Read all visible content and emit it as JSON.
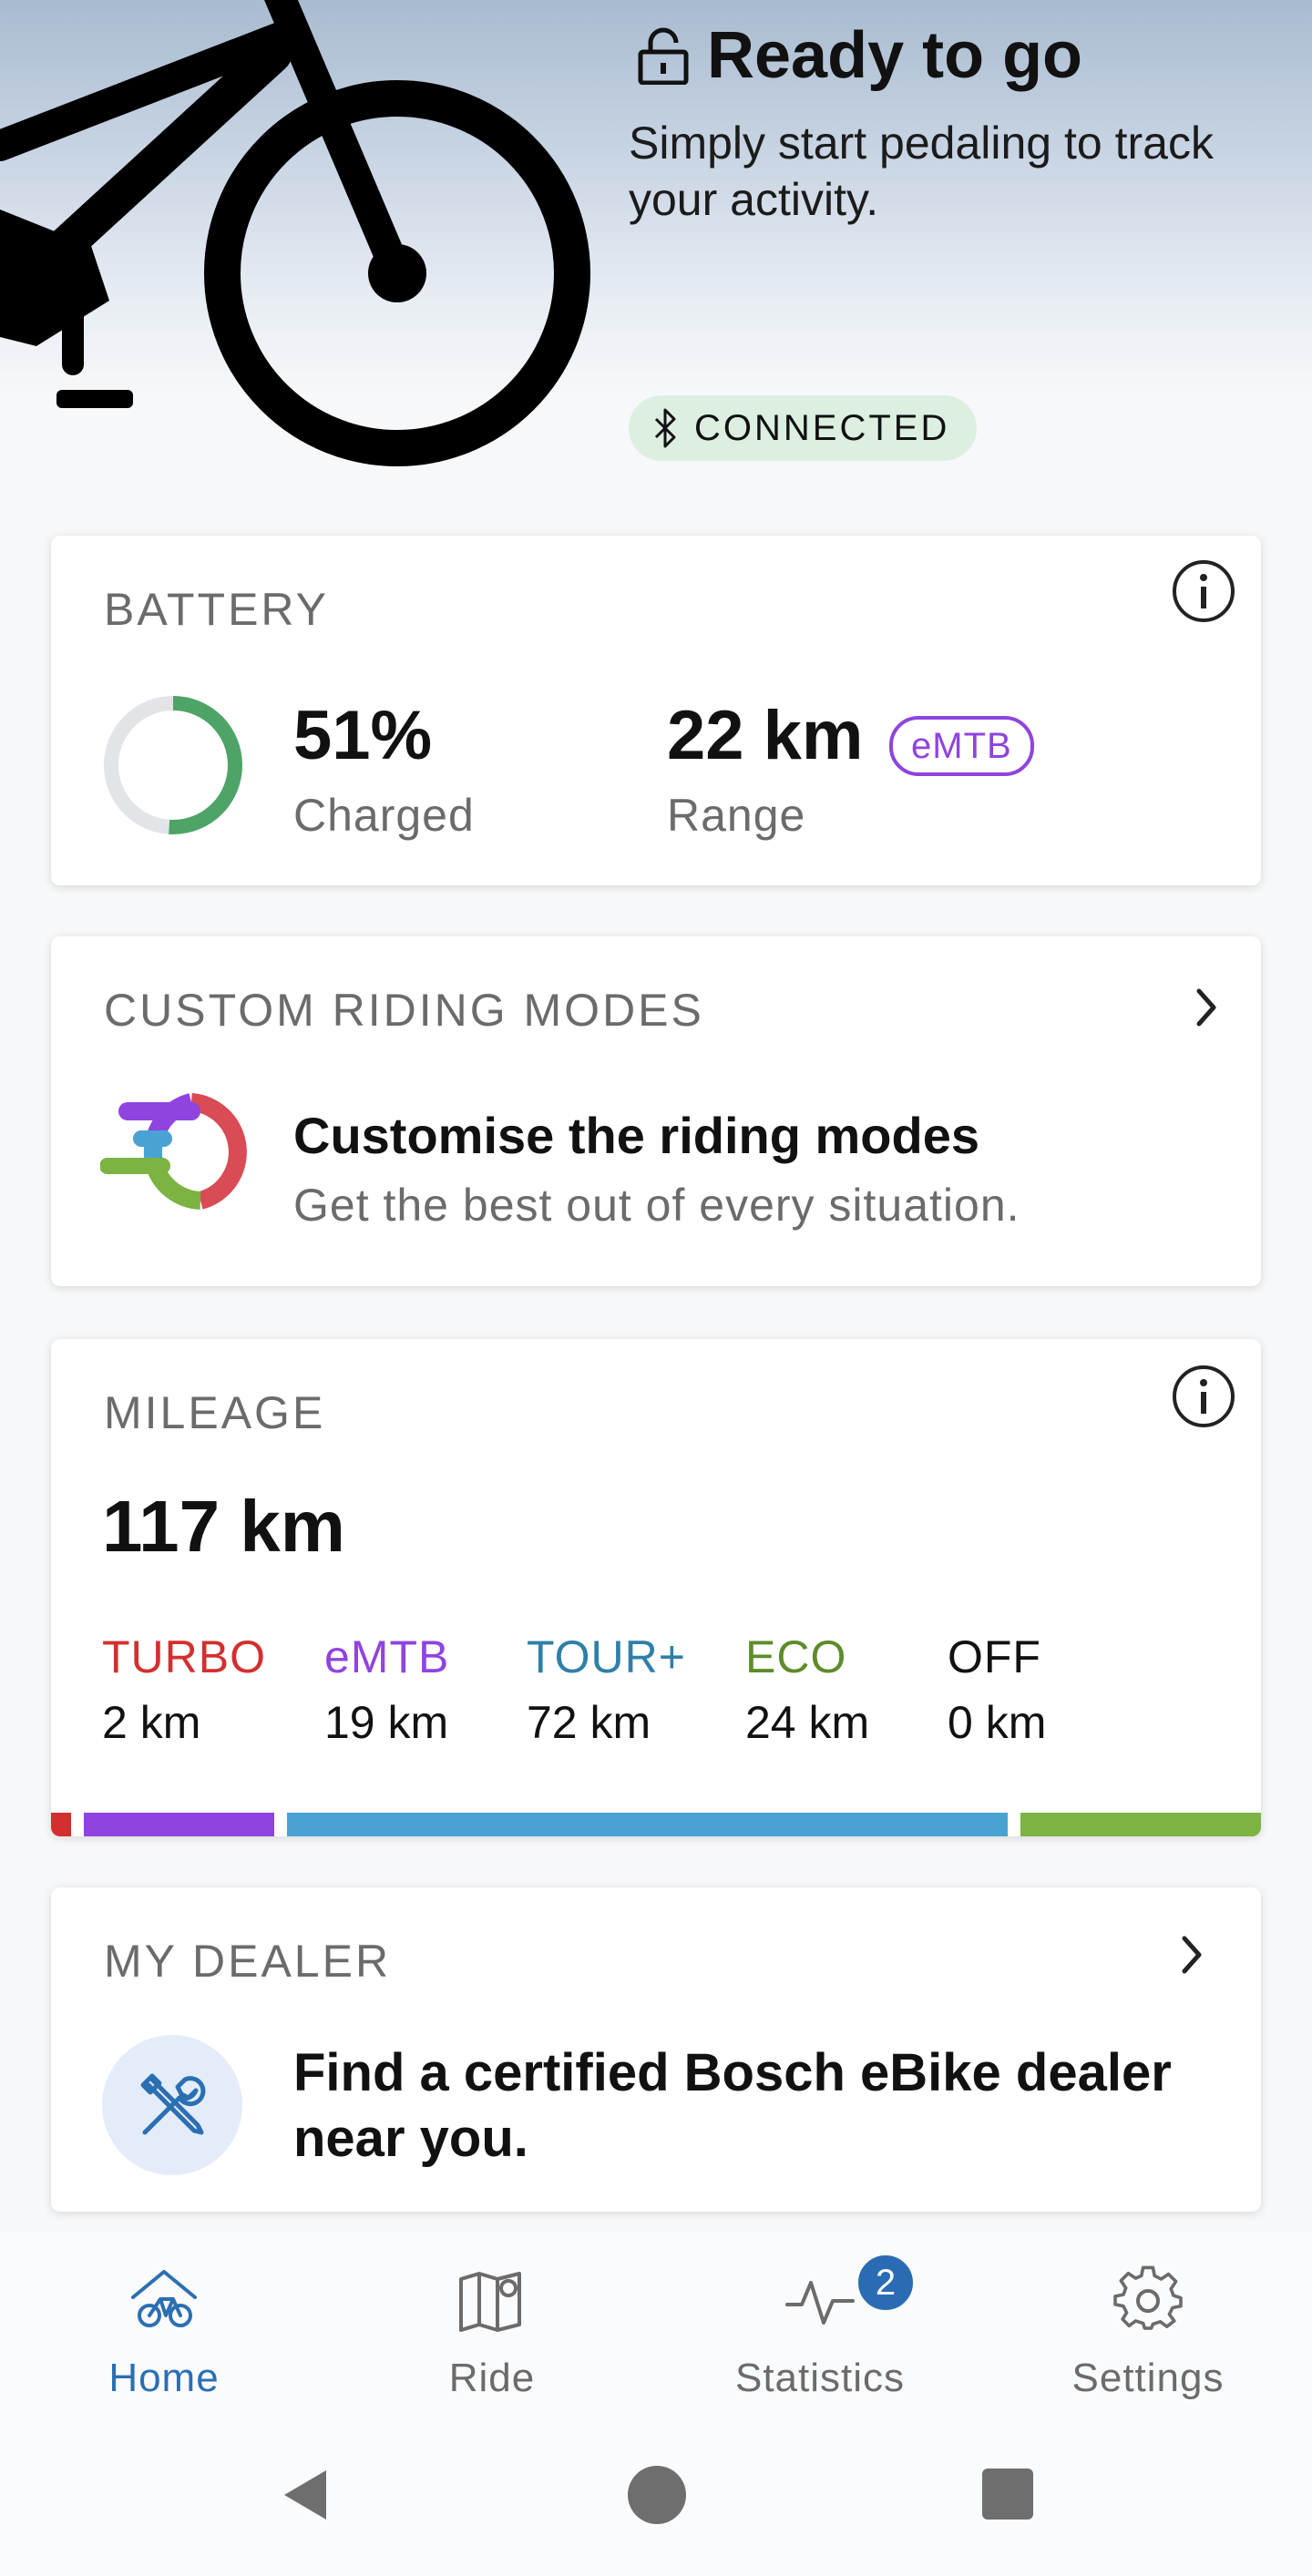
{
  "header": {
    "status_title": "Ready to go",
    "status_subtitle": "Simply start pedaling to track your activity.",
    "connection_label": "CONNECTED"
  },
  "battery": {
    "title": "BATTERY",
    "charge_value": "51%",
    "charge_label": "Charged",
    "charge_fraction": 0.51,
    "range_value": "22 km",
    "range_mode_badge": "eMTB",
    "range_label": "Range"
  },
  "riding_modes": {
    "title": "CUSTOM RIDING MODES",
    "heading": "Customise the riding modes",
    "subtitle": "Get the best out of every situation."
  },
  "mileage": {
    "title": "MILEAGE",
    "total": "117 km",
    "modes": [
      {
        "name": "TURBO",
        "distance": "2 km",
        "km": 2,
        "color": "#d32f2f"
      },
      {
        "name": "eMTB",
        "distance": "19 km",
        "km": 19,
        "color": "#8f44df"
      },
      {
        "name": "TOUR+",
        "distance": "72 km",
        "km": 72,
        "color": "#2f7fa8"
      },
      {
        "name": "ECO",
        "distance": "24 km",
        "km": 24,
        "color": "#5e8c2a"
      },
      {
        "name": "OFF",
        "distance": "0 km",
        "km": 0,
        "color": "#111111"
      }
    ],
    "bar_colors": [
      "#d32f2f",
      "#8f44df",
      "#4aa2d4",
      "#7cb342"
    ]
  },
  "dealer": {
    "title": "MY DEALER",
    "text": "Find a certified Bosch eBike dealer near you."
  },
  "nav": {
    "items": [
      {
        "label": "Home",
        "icon": "home-ebike-icon",
        "active": true
      },
      {
        "label": "Ride",
        "icon": "map-icon",
        "active": false
      },
      {
        "label": "Statistics",
        "icon": "activity-icon",
        "active": false,
        "badge": "2"
      },
      {
        "label": "Settings",
        "icon": "gear-icon",
        "active": false
      }
    ]
  },
  "colors": {
    "accent": "#2b6fb3",
    "battery_green": "#4ea466",
    "connected_bg": "#dcefe1"
  }
}
